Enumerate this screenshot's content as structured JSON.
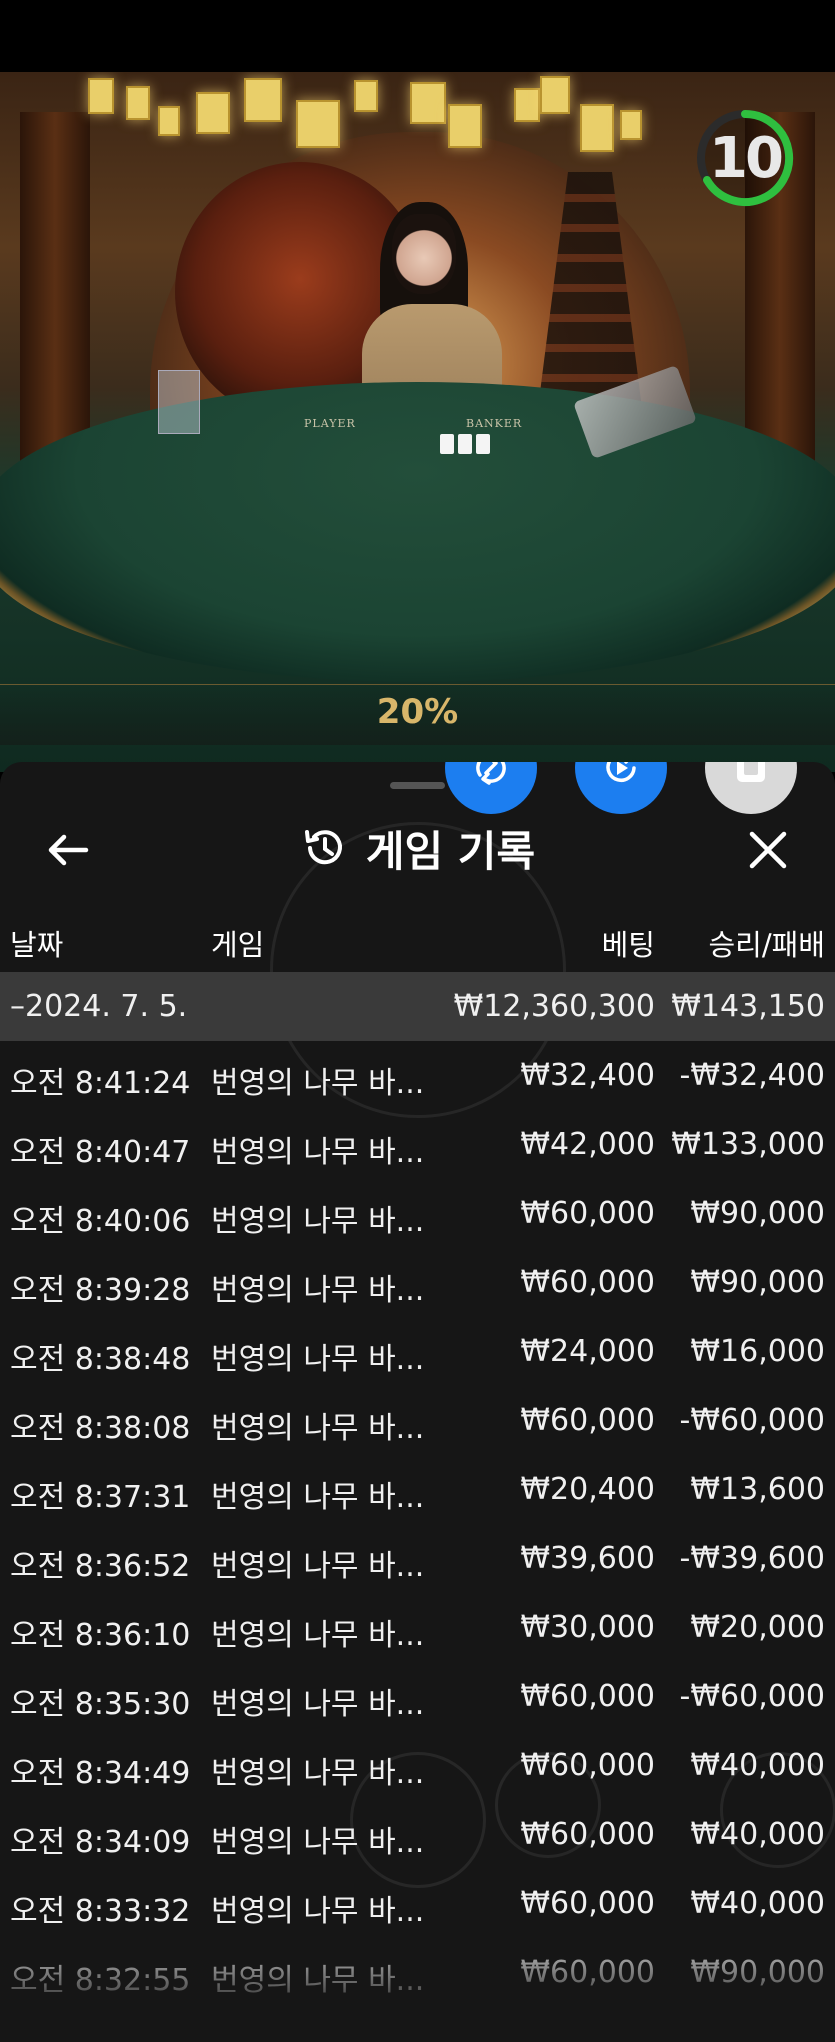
{
  "video": {
    "timer_value": "10",
    "percent_text": "20%",
    "table_labels": [
      "PLAYER",
      "BANKER"
    ]
  },
  "controls": {
    "icons": [
      "sync-icon",
      "replay-icon",
      "stop-icon"
    ],
    "accent": "#1c7ef0"
  },
  "panel": {
    "title": "게임 기록",
    "back_icon": "arrow-left-icon",
    "history_icon": "history-icon",
    "close_icon": "close-icon"
  },
  "columns": {
    "date": "날짜",
    "game": "게임",
    "bet": "베팅",
    "win_loss": "승리/패배"
  },
  "group_row": {
    "date": "–2024. 7. 5.",
    "bet": "₩12,360,300",
    "win_loss": "₩143,150"
  },
  "rows": [
    {
      "date": "오전 8:41:24",
      "game": "번영의 나무 바...",
      "bet": "₩32,400",
      "win_loss": "-₩32,400"
    },
    {
      "date": "오전 8:40:47",
      "game": "번영의 나무 바...",
      "bet": "₩42,000",
      "win_loss": "₩133,000"
    },
    {
      "date": "오전 8:40:06",
      "game": "번영의 나무 바...",
      "bet": "₩60,000",
      "win_loss": "₩90,000"
    },
    {
      "date": "오전 8:39:28",
      "game": "번영의 나무 바...",
      "bet": "₩60,000",
      "win_loss": "₩90,000"
    },
    {
      "date": "오전 8:38:48",
      "game": "번영의 나무 바...",
      "bet": "₩24,000",
      "win_loss": "₩16,000"
    },
    {
      "date": "오전 8:38:08",
      "game": "번영의 나무 바...",
      "bet": "₩60,000",
      "win_loss": "-₩60,000"
    },
    {
      "date": "오전 8:37:31",
      "game": "번영의 나무 바...",
      "bet": "₩20,400",
      "win_loss": "₩13,600"
    },
    {
      "date": "오전 8:36:52",
      "game": "번영의 나무 바...",
      "bet": "₩39,600",
      "win_loss": "-₩39,600"
    },
    {
      "date": "오전 8:36:10",
      "game": "번영의 나무 바...",
      "bet": "₩30,000",
      "win_loss": "₩20,000"
    },
    {
      "date": "오전 8:35:30",
      "game": "번영의 나무 바...",
      "bet": "₩60,000",
      "win_loss": "-₩60,000"
    },
    {
      "date": "오전 8:34:49",
      "game": "번영의 나무 바...",
      "bet": "₩60,000",
      "win_loss": "₩40,000"
    },
    {
      "date": "오전 8:34:09",
      "game": "번영의 나무 바...",
      "bet": "₩60,000",
      "win_loss": "₩40,000"
    },
    {
      "date": "오전 8:33:32",
      "game": "번영의 나무 바...",
      "bet": "₩60,000",
      "win_loss": "₩40,000"
    },
    {
      "date": "오전 8:32:55",
      "game": "번영의 나무 바...",
      "bet": "₩60,000",
      "win_loss": "₩90,000"
    }
  ]
}
